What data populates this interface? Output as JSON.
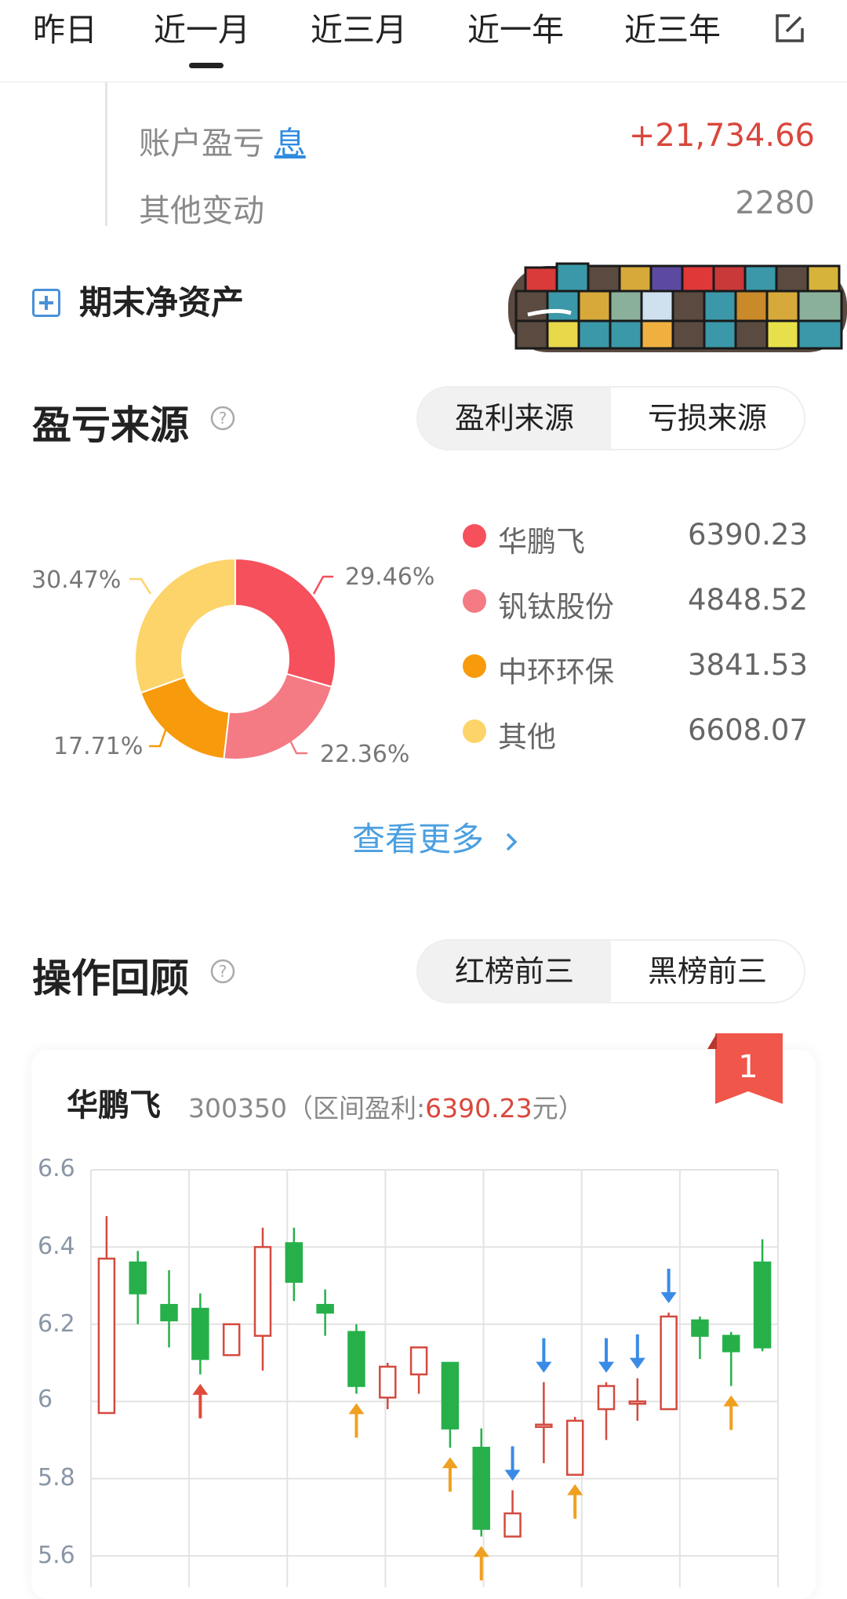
{
  "tabs": [
    "昨日",
    "近一月",
    "近三月",
    "近一年",
    "近三年"
  ],
  "active_tab": "近一月",
  "header_icons": {
    "edit": "edit-icon"
  },
  "summary": {
    "account_pl_label": "账户盈亏",
    "account_pl_link": "息",
    "account_pl_value": "+21,734.66",
    "other_change_label": "其他变动",
    "other_change_value": "2280"
  },
  "net_assets": {
    "label": "期末净资产",
    "icon": "plus-square-icon"
  },
  "pl_source": {
    "title": "盈亏来源",
    "help_icon": "question-circle-icon",
    "segments": [
      "盈利来源",
      "亏损来源"
    ],
    "active_segment": "盈利来源",
    "more": "查看更多",
    "legend": [
      {
        "name": "华鹏飞",
        "value": "6390.23",
        "color": "#f5505c"
      },
      {
        "name": "钒钛股份",
        "value": "4848.52",
        "color": "#f47a84"
      },
      {
        "name": "中环环保",
        "value": "3841.53",
        "color": "#f79a0c"
      },
      {
        "name": "其他",
        "value": "6608.07",
        "color": "#fcd46a"
      }
    ],
    "percents": [
      "29.46%",
      "22.36%",
      "17.71%",
      "30.47%"
    ]
  },
  "review": {
    "title": "操作回顾",
    "segments": [
      "红榜前三",
      "黑榜前三"
    ],
    "active_segment": "红榜前三",
    "card": {
      "rank": "1",
      "stock_name": "华鹏飞",
      "stock_code": "300350",
      "profit_prefix": "（区间盈利:",
      "profit_value": "6390.23",
      "profit_suffix": "元）"
    }
  },
  "chart_data": {
    "type": "candlestick",
    "yticks": [
      "6.6",
      "6.4",
      "6.2",
      "6",
      "5.8",
      "5.6"
    ],
    "ylim": [
      5.55,
      6.6
    ],
    "colors": {
      "up": "#d34a3f",
      "down": "#27b04a",
      "buy": "#f0a020",
      "sell": "#3a8be6",
      "buy_red": "#e04a3a"
    },
    "candles": [
      {
        "o": 5.97,
        "c": 6.37,
        "h": 6.48,
        "l": 5.97
      },
      {
        "o": 6.36,
        "c": 6.28,
        "h": 6.39,
        "l": 6.2
      },
      {
        "o": 6.25,
        "c": 6.21,
        "h": 6.34,
        "l": 6.14
      },
      {
        "o": 6.24,
        "c": 6.11,
        "h": 6.28,
        "l": 6.07
      },
      {
        "o": 6.12,
        "c": 6.2,
        "h": 6.2,
        "l": 6.12
      },
      {
        "o": 6.17,
        "c": 6.4,
        "h": 6.45,
        "l": 6.08
      },
      {
        "o": 6.41,
        "c": 6.31,
        "h": 6.45,
        "l": 6.26
      },
      {
        "o": 6.25,
        "c": 6.23,
        "h": 6.29,
        "l": 6.17
      },
      {
        "o": 6.18,
        "c": 6.04,
        "h": 6.2,
        "l": 6.02
      },
      {
        "o": 6.01,
        "c": 6.09,
        "h": 6.1,
        "l": 5.98
      },
      {
        "o": 6.07,
        "c": 6.14,
        "h": 6.14,
        "l": 6.02
      },
      {
        "o": 6.1,
        "c": 5.93,
        "h": 6.1,
        "l": 5.88
      },
      {
        "o": 5.88,
        "c": 5.67,
        "h": 5.93,
        "l": 5.65
      },
      {
        "o": 5.65,
        "c": 5.71,
        "h": 5.77,
        "l": 5.65
      },
      {
        "o": 5.94,
        "c": 5.94,
        "h": 6.05,
        "l": 5.84
      },
      {
        "o": 5.81,
        "c": 5.95,
        "h": 5.96,
        "l": 5.81
      },
      {
        "o": 5.98,
        "c": 6.04,
        "h": 6.05,
        "l": 5.9
      },
      {
        "o": 6.0,
        "c": 6.0,
        "h": 6.06,
        "l": 5.95
      },
      {
        "o": 5.98,
        "c": 6.22,
        "h": 6.23,
        "l": 5.98
      },
      {
        "o": 6.21,
        "c": 6.17,
        "h": 6.22,
        "l": 6.11
      },
      {
        "o": 6.17,
        "c": 6.13,
        "h": 6.18,
        "l": 6.04
      },
      {
        "o": 6.36,
        "c": 6.14,
        "h": 6.42,
        "l": 6.13
      }
    ],
    "markers": [
      {
        "i": 3,
        "type": "buy_red"
      },
      {
        "i": 8,
        "type": "buy"
      },
      {
        "i": 11,
        "type": "buy"
      },
      {
        "i": 12,
        "type": "buy"
      },
      {
        "i": 13,
        "type": "sell"
      },
      {
        "i": 14,
        "type": "sell"
      },
      {
        "i": 15,
        "type": "buy"
      },
      {
        "i": 16,
        "type": "sell"
      },
      {
        "i": 17,
        "type": "sell"
      },
      {
        "i": 18,
        "type": "sell"
      },
      {
        "i": 20,
        "type": "buy"
      }
    ]
  }
}
